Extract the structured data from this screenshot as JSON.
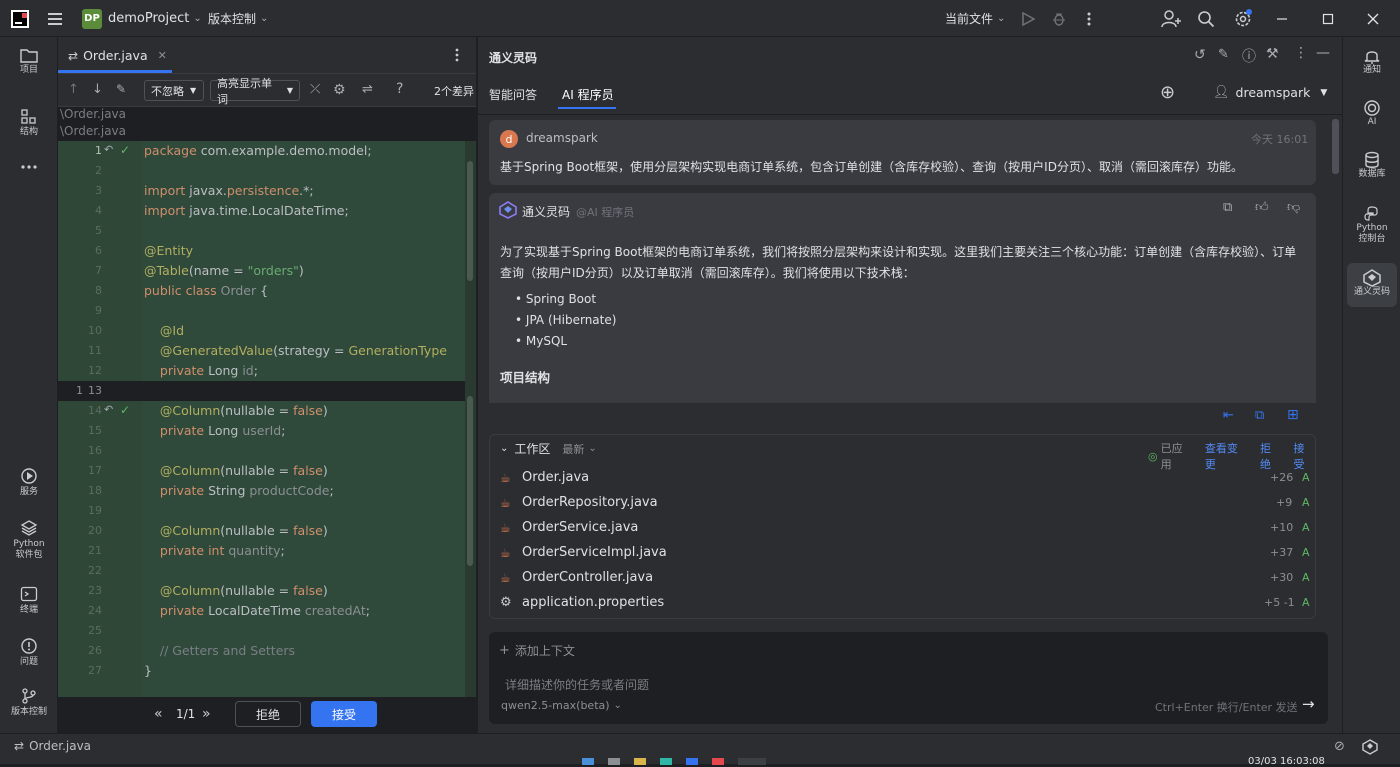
{
  "titlebar": {
    "project_badge": "DP",
    "project_name": "demoProject",
    "vcs_menu": "版本控制",
    "run_config": "当前文件"
  },
  "leftbar": {
    "project": "项目",
    "structure": "结构",
    "services": "服务",
    "python_packages_1": "Python",
    "python_packages_2": "软件包",
    "terminal": "终端",
    "problems": "问题",
    "vcs": "版本控制"
  },
  "editor": {
    "tab_label": "Order.java",
    "ignore_select": "不忽略",
    "highlight_select": "高亮显示单词",
    "diff_count": "2个差异",
    "path_1": "\\Order.java",
    "path_2": "\\Order.java",
    "nav_counter": "1/1",
    "reject_label": "拒绝",
    "accept_label": "接受"
  },
  "code_lines": [
    {
      "n": "1",
      "t": "package com.example.demo.model;"
    },
    {
      "n": "2",
      "t": ""
    },
    {
      "n": "3",
      "t": "import javax.persistence.*;"
    },
    {
      "n": "4",
      "t": "import java.time.LocalDateTime;"
    },
    {
      "n": "5",
      "t": ""
    },
    {
      "n": "6",
      "t": "@Entity"
    },
    {
      "n": "7",
      "t": "@Table(name = \"orders\")"
    },
    {
      "n": "8",
      "t": "public class Order {"
    },
    {
      "n": "9",
      "t": ""
    },
    {
      "n": "10",
      "t": "    @Id"
    },
    {
      "n": "11",
      "t": "    @GeneratedValue(strategy = GenerationType"
    },
    {
      "n": "12",
      "t": "    private Long id;"
    },
    {
      "n": "13",
      "t": ""
    },
    {
      "n": "14",
      "t": "    @Column(nullable = false)"
    },
    {
      "n": "15",
      "t": "    private Long userId;"
    },
    {
      "n": "16",
      "t": ""
    },
    {
      "n": "17",
      "t": "    @Column(nullable = false)"
    },
    {
      "n": "18",
      "t": "    private String productCode;"
    },
    {
      "n": "19",
      "t": ""
    },
    {
      "n": "20",
      "t": "    @Column(nullable = false)"
    },
    {
      "n": "21",
      "t": "    private int quantity;"
    },
    {
      "n": "22",
      "t": ""
    },
    {
      "n": "23",
      "t": "    @Column(nullable = false)"
    },
    {
      "n": "24",
      "t": "    private LocalDateTime createdAt;"
    },
    {
      "n": "25",
      "t": ""
    },
    {
      "n": "26",
      "t": "    // Getters and Setters"
    },
    {
      "n": "27",
      "t": "}"
    }
  ],
  "assistant": {
    "title": "通义灵码",
    "tab_qa": "智能问答",
    "tab_ai": "AI 程序员",
    "user_name": "dreamspark",
    "user_initial": "d",
    "user_msg_name": "dreamspark",
    "user_msg_time": "今天 16:01",
    "user_msg_text": "基于Spring Boot框架，使用分层架构实现电商订单系统，包含订单创建（含库存校验）、查询（按用户ID分页）、取消（需回滚库存）功能。",
    "bot_name": "通义灵码",
    "bot_tag": "@AI 程序员",
    "bot_intro": "为了实现基于Spring Boot框架的电商订单系统，我们将按照分层架构来设计和实现。这里我们主要关注三个核心功能：订单创建（含库存校验）、订单查询（按用户ID分页）以及订单取消（需回滚库存）。我们将使用以下技术栈：",
    "bullets": [
      "Spring Boot",
      "JPA (Hibernate)",
      "MySQL"
    ],
    "section_heading": "项目结构"
  },
  "workspace": {
    "label": "工作区",
    "filter": "最新",
    "applied": "已应用",
    "view_changes": "查看变更",
    "reject": "拒绝",
    "accept": "接受",
    "files": [
      {
        "name": "Order.java",
        "diff": "+26",
        "status": "A",
        "icon": "java-file-icon"
      },
      {
        "name": "OrderRepository.java",
        "diff": "+9",
        "status": "A",
        "icon": "java-file-icon"
      },
      {
        "name": "OrderService.java",
        "diff": "+10",
        "status": "A",
        "icon": "java-file-icon"
      },
      {
        "name": "OrderServiceImpl.java",
        "diff": "+37",
        "status": "A",
        "icon": "java-file-icon"
      },
      {
        "name": "OrderController.java",
        "diff": "+30",
        "status": "A",
        "icon": "java-file-icon"
      },
      {
        "name": "application.properties",
        "diff": "+5 -1",
        "status": "A",
        "icon": "gear-icon"
      }
    ]
  },
  "input": {
    "add_context": "添加上下文",
    "placeholder": "详细描述你的任务或者问题",
    "model": "qwen2.5-max(beta)",
    "hint": "Ctrl+Enter 换行/Enter 发送"
  },
  "rightbar": {
    "notifications": "通知",
    "ai": "AI",
    "database": "数据库",
    "python_console_1": "Python",
    "python_console_2": "控制台",
    "tongyi": "通义灵码"
  },
  "status": {
    "file": "Order.java",
    "clock": "03/03 16:03:08"
  },
  "colors": {
    "accent": "#3574f0",
    "diff_bg": "#2f4a3a",
    "added": "#5fb865",
    "orange": "#d9784f"
  }
}
